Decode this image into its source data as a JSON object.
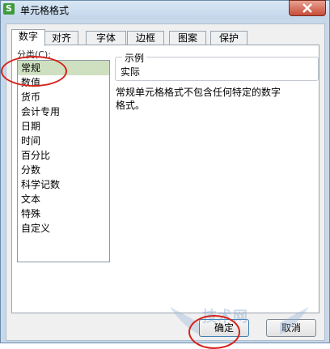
{
  "window": {
    "title": "单元格格式"
  },
  "tabs": [
    "数字",
    "对齐",
    "字体",
    "边框",
    "图案",
    "保护"
  ],
  "category": {
    "label": "分类(C):",
    "items": [
      "常规",
      "数值",
      "货币",
      "会计专用",
      "日期",
      "时间",
      "百分比",
      "分数",
      "科学记数",
      "文本",
      "特殊",
      "自定义"
    ],
    "selected": "常规"
  },
  "sample": {
    "label": "示例",
    "value": "实际"
  },
  "description": "常规单元格格式不包含任何特定的数字格式。",
  "buttons": {
    "ok": "确定",
    "cancel": "取消"
  },
  "watermark": {
    "text": "技术网"
  },
  "colors": {
    "annotation": "#d7221a",
    "selected_bg": "#cfe0c0",
    "titlebar": "#c3d6ea",
    "close": "#c74c39"
  }
}
